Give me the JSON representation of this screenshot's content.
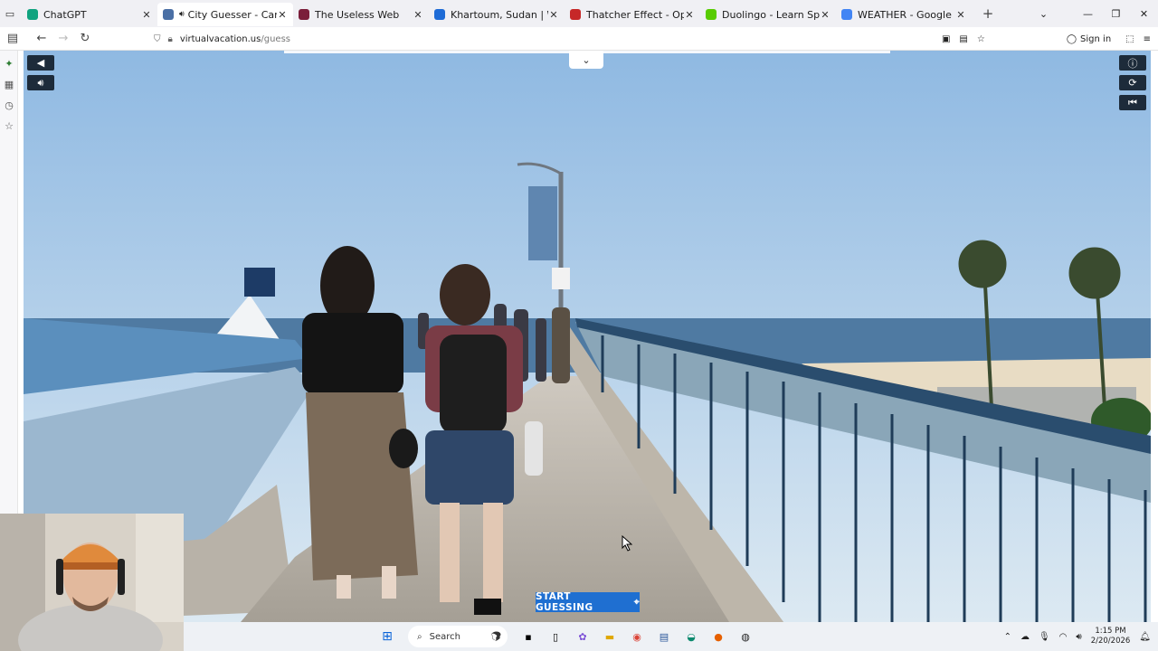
{
  "browser": {
    "tabs": [
      {
        "title": "ChatGPT",
        "active": false,
        "icon": "chatgpt-icon",
        "color": "#10a37f"
      },
      {
        "title": "City Guesser - Can you gue",
        "active": true,
        "icon": "globe-icon",
        "color": "#4a6fa5"
      },
      {
        "title": "The Useless Web",
        "active": false,
        "icon": "useless-web-icon",
        "color": "#7b1e3a"
      },
      {
        "title": "Khartoum, Sudan | Weather Sat",
        "active": false,
        "icon": "weather-icon",
        "color": "#1e6bd6"
      },
      {
        "title": "Thatcher Effect - Optical Illusio",
        "active": false,
        "icon": "red-circle-icon",
        "color": "#c62828"
      },
      {
        "title": "Duolingo - Learn Spanish with",
        "active": false,
        "icon": "duolingo-icon",
        "color": "#58cc02"
      },
      {
        "title": "WEATHER - Google Search",
        "active": false,
        "icon": "google-icon",
        "color": "#4285f4"
      }
    ],
    "url_domain": "virtualvacation.us",
    "url_path": "/guess",
    "sign_in_label": "Sign in"
  },
  "game": {
    "start_button_label": "START GUESSING",
    "start_button_color": "#1f6fd1"
  },
  "taskbar": {
    "search_label": "Search",
    "time": "1:15 PM",
    "date": "2/20/2026"
  }
}
